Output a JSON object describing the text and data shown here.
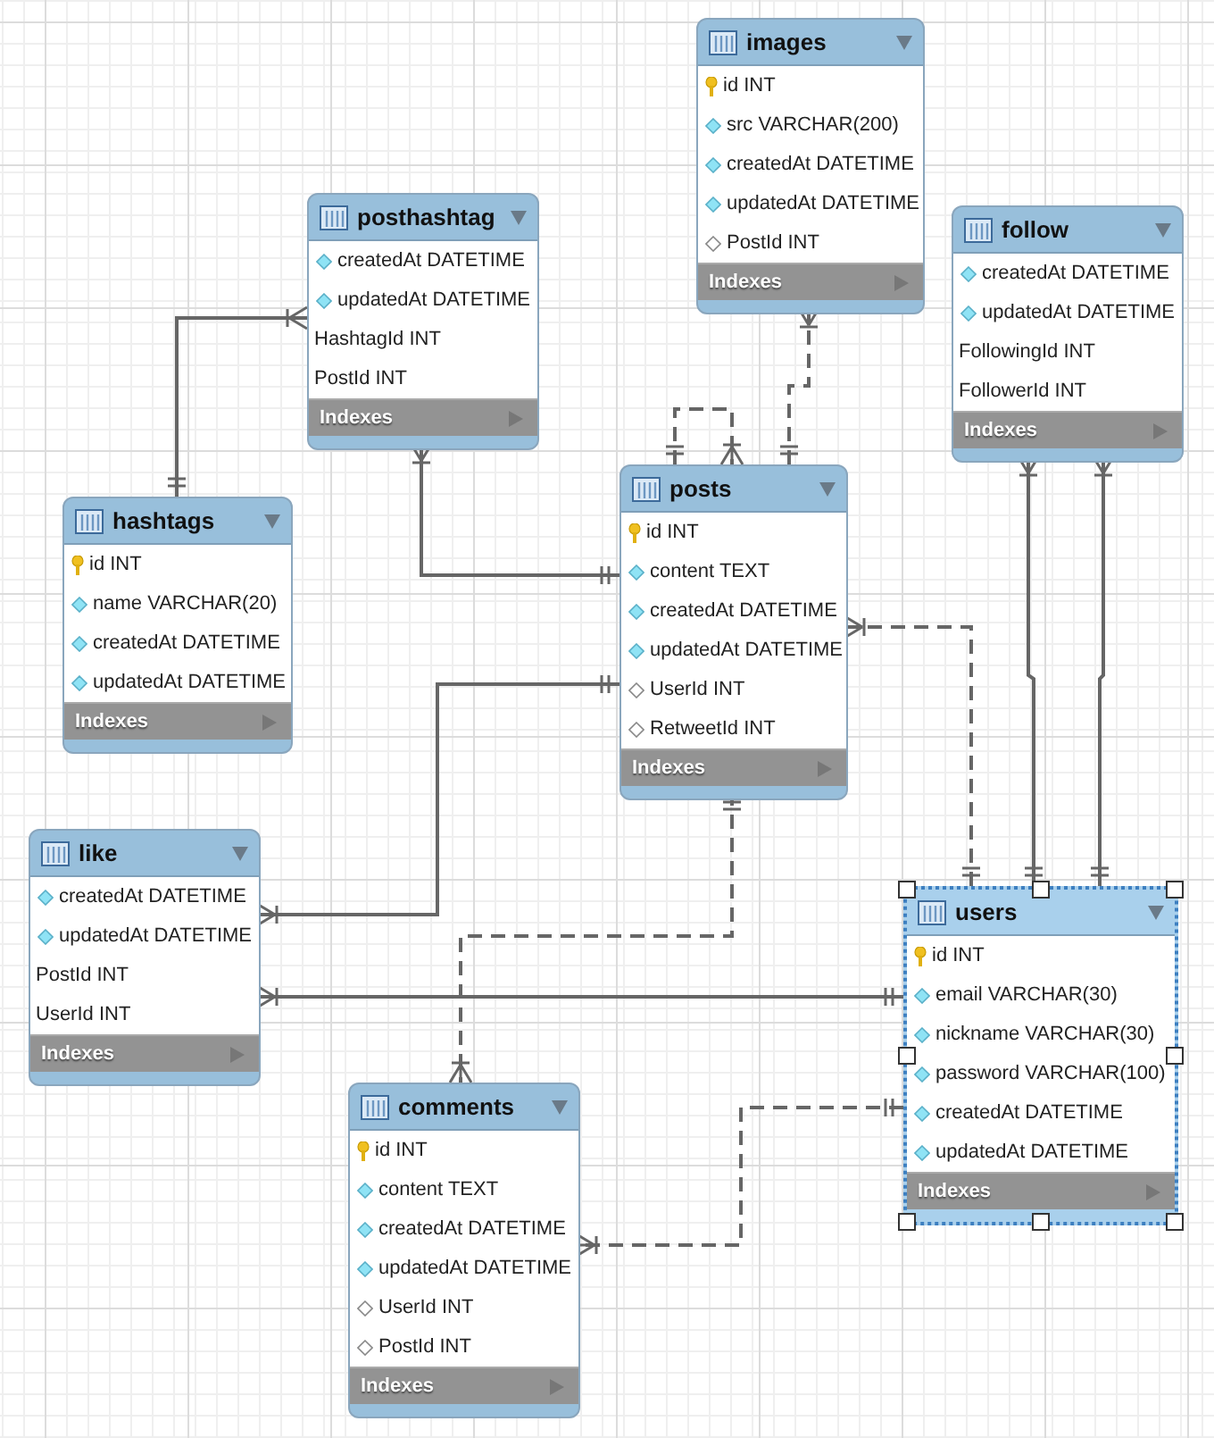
{
  "tables": [
    {
      "name": "images",
      "selected": false,
      "indexes_label": "Indexes",
      "columns": [
        {
          "text": "id INT",
          "kind": "key"
        },
        {
          "text": "src VARCHAR(200)",
          "kind": "filled"
        },
        {
          "text": "createdAt DATETIME",
          "kind": "filled"
        },
        {
          "text": "updatedAt DATETIME",
          "kind": "filled"
        },
        {
          "text": "PostId INT",
          "kind": "open"
        }
      ]
    },
    {
      "name": "posthashtag",
      "selected": false,
      "indexes_label": "Indexes",
      "columns": [
        {
          "text": "createdAt DATETIME",
          "kind": "filled"
        },
        {
          "text": "updatedAt DATETIME",
          "kind": "filled"
        },
        {
          "text": "HashtagId INT",
          "kind": "plain"
        },
        {
          "text": "PostId INT",
          "kind": "plain"
        }
      ]
    },
    {
      "name": "follow",
      "selected": false,
      "indexes_label": "Indexes",
      "columns": [
        {
          "text": "createdAt DATETIME",
          "kind": "filled"
        },
        {
          "text": "updatedAt DATETIME",
          "kind": "filled"
        },
        {
          "text": "FollowingId INT",
          "kind": "plain"
        },
        {
          "text": "FollowerId INT",
          "kind": "plain"
        }
      ]
    },
    {
      "name": "hashtags",
      "selected": false,
      "indexes_label": "Indexes",
      "columns": [
        {
          "text": "id INT",
          "kind": "key"
        },
        {
          "text": "name VARCHAR(20)",
          "kind": "filled"
        },
        {
          "text": "createdAt DATETIME",
          "kind": "filled"
        },
        {
          "text": "updatedAt DATETIME",
          "kind": "filled"
        }
      ]
    },
    {
      "name": "posts",
      "selected": false,
      "indexes_label": "Indexes",
      "columns": [
        {
          "text": "id INT",
          "kind": "key"
        },
        {
          "text": "content TEXT",
          "kind": "filled"
        },
        {
          "text": "createdAt DATETIME",
          "kind": "filled"
        },
        {
          "text": "updatedAt DATETIME",
          "kind": "filled"
        },
        {
          "text": "UserId INT",
          "kind": "open"
        },
        {
          "text": "RetweetId INT",
          "kind": "open"
        }
      ]
    },
    {
      "name": "like",
      "selected": false,
      "indexes_label": "Indexes",
      "columns": [
        {
          "text": "createdAt DATETIME",
          "kind": "filled"
        },
        {
          "text": "updatedAt DATETIME",
          "kind": "filled"
        },
        {
          "text": "PostId INT",
          "kind": "plain"
        },
        {
          "text": "UserId INT",
          "kind": "plain"
        }
      ]
    },
    {
      "name": "users",
      "selected": true,
      "indexes_label": "Indexes",
      "columns": [
        {
          "text": "id INT",
          "kind": "key"
        },
        {
          "text": "email VARCHAR(30)",
          "kind": "filled"
        },
        {
          "text": "nickname VARCHAR(30)",
          "kind": "filled"
        },
        {
          "text": "password VARCHAR(100)",
          "kind": "filled"
        },
        {
          "text": "createdAt DATETIME",
          "kind": "filled"
        },
        {
          "text": "updatedAt DATETIME",
          "kind": "filled"
        }
      ]
    },
    {
      "name": "comments",
      "selected": false,
      "indexes_label": "Indexes",
      "columns": [
        {
          "text": "id INT",
          "kind": "key"
        },
        {
          "text": "content TEXT",
          "kind": "filled"
        },
        {
          "text": "createdAt DATETIME",
          "kind": "filled"
        },
        {
          "text": "updatedAt DATETIME",
          "kind": "filled"
        },
        {
          "text": "UserId INT",
          "kind": "open"
        },
        {
          "text": "PostId INT",
          "kind": "open"
        }
      ]
    }
  ]
}
